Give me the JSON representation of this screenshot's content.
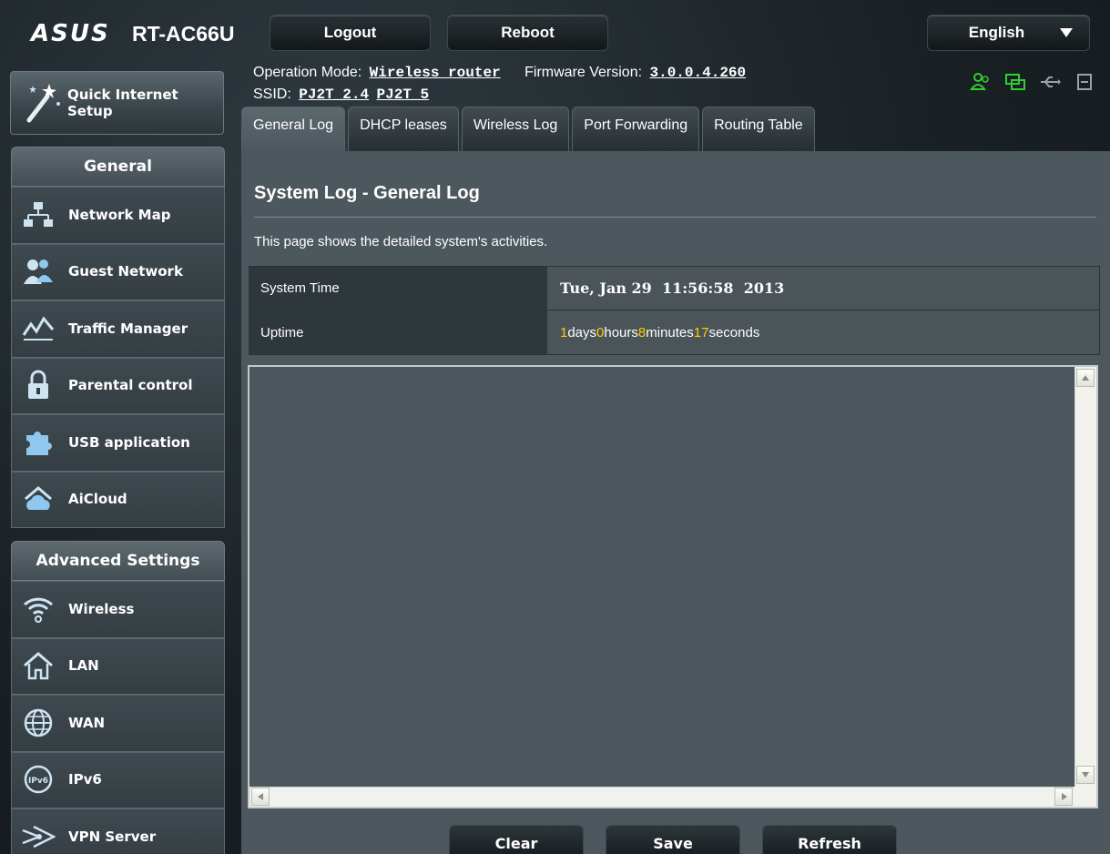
{
  "header": {
    "logo": "ASUS",
    "model": "RT-AC66U",
    "logout_label": "Logout",
    "reboot_label": "Reboot",
    "language": "English"
  },
  "info": {
    "operation_mode_label": "Operation Mode:",
    "operation_mode": "Wireless router",
    "firmware_label": "Firmware Version:",
    "firmware": "3.0.0.4.260",
    "ssid_label": "SSID:",
    "ssid_1": "PJ2T_2.4",
    "ssid_2": "PJ2T_5",
    "status_icons": [
      "client-status-icon",
      "network-status-icon",
      "usb-status-icon",
      "printer-status-icon"
    ],
    "status_color": "#33cc33"
  },
  "sidebar": {
    "qis_label_1": "Quick Internet",
    "qis_label_2": "Setup",
    "general_title": "General",
    "general_items": [
      {
        "label": "Network Map",
        "icon": "network-map-icon"
      },
      {
        "label": "Guest Network",
        "icon": "guest-network-icon"
      },
      {
        "label": "Traffic Manager",
        "icon": "traffic-manager-icon"
      },
      {
        "label": "Parental control",
        "icon": "lock-icon"
      },
      {
        "label": "USB application",
        "icon": "puzzle-icon"
      },
      {
        "label": "AiCloud",
        "icon": "cloud-home-icon"
      }
    ],
    "advanced_title": "Advanced Settings",
    "advanced_items": [
      {
        "label": "Wireless",
        "icon": "wifi-icon"
      },
      {
        "label": "LAN",
        "icon": "home-icon"
      },
      {
        "label": "WAN",
        "icon": "globe-icon"
      },
      {
        "label": "IPv6",
        "icon": "ipv6-icon"
      },
      {
        "label": "VPN Server",
        "icon": "vpn-icon"
      }
    ]
  },
  "tabs": [
    {
      "label": "General Log",
      "active": true
    },
    {
      "label": "DHCP leases",
      "active": false
    },
    {
      "label": "Wireless Log",
      "active": false
    },
    {
      "label": "Port Forwarding",
      "active": false
    },
    {
      "label": "Routing Table",
      "active": false
    }
  ],
  "main": {
    "title": "System Log - General Log",
    "description": "This page shows the detailed system's activities.",
    "system_time_label": "System Time",
    "system_time": "Tue, Jan 29  11:56:58  2013",
    "uptime_label": "Uptime",
    "uptime": {
      "days": "1",
      "days_unit": "days",
      "hours": "0",
      "hours_unit": "hours",
      "minutes": "8",
      "minutes_unit": "minutes",
      "seconds": "17",
      "seconds_unit": "seconds"
    },
    "log_content": "",
    "clear_label": "Clear",
    "save_label": "Save",
    "refresh_label": "Refresh"
  }
}
